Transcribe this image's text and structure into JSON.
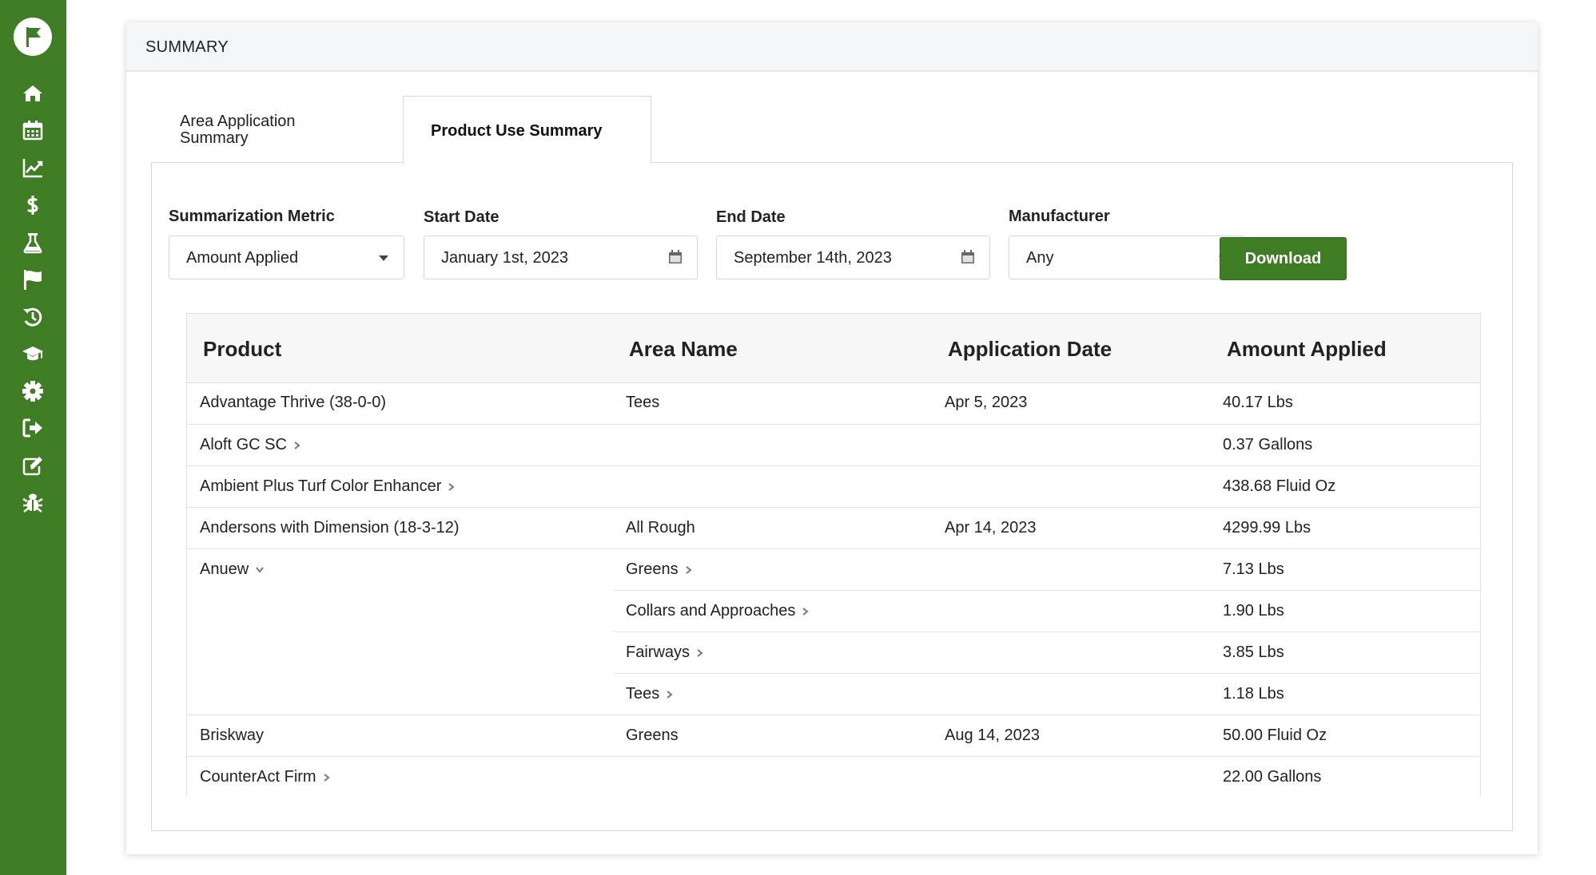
{
  "card": {
    "title": "SUMMARY"
  },
  "tabs": [
    {
      "label": "Area Application Summary",
      "active": false
    },
    {
      "label": "Product Use Summary",
      "active": true
    }
  ],
  "filters": {
    "metric": {
      "label": "Summarization Metric",
      "value": "Amount Applied"
    },
    "start_date": {
      "label": "Start Date",
      "value": "January 1st, 2023"
    },
    "end_date": {
      "label": "End Date",
      "value": "September 14th, 2023"
    },
    "manufacturer": {
      "label": "Manufacturer",
      "value": "Any"
    },
    "download_label": "Download"
  },
  "table": {
    "columns": [
      "Product",
      "Area Name",
      "Application Date",
      "Amount Applied"
    ],
    "rows": [
      {
        "product": "Advantage Thrive (38-0-0)",
        "area": "Tees",
        "date": "Apr 5, 2023",
        "amount": "40.17 Lbs"
      },
      {
        "product": "Aloft GC SC",
        "product_chevron": "right",
        "area": "",
        "date": "",
        "amount": "0.37 Gallons"
      },
      {
        "product": "Ambient Plus Turf Color Enhancer",
        "product_chevron": "right",
        "area": "",
        "date": "",
        "amount": "438.68 Fluid Oz"
      },
      {
        "product": "Andersons with Dimension (18-3-12)",
        "area": "All Rough",
        "date": "Apr 14, 2023",
        "amount": "4299.99 Lbs"
      },
      {
        "product": "Anuew",
        "product_chevron": "down",
        "area": "Greens",
        "area_chevron": "right",
        "date": "",
        "amount": "7.13 Lbs"
      },
      {
        "product": "",
        "area": "Collars and Approaches",
        "area_chevron": "right",
        "date": "",
        "amount": "1.90 Lbs"
      },
      {
        "product": "",
        "area": "Fairways",
        "area_chevron": "right",
        "date": "",
        "amount": "3.85 Lbs"
      },
      {
        "product": "",
        "area": "Tees",
        "area_chevron": "right",
        "date": "",
        "amount": "1.18 Lbs"
      },
      {
        "product": "Briskway",
        "area": "Greens",
        "date": "Aug 14, 2023",
        "amount": "50.00 Fluid Oz"
      },
      {
        "product": "CounterAct Firm",
        "product_chevron": "right",
        "area": "",
        "date": "",
        "amount": "22.00 Gallons"
      }
    ]
  },
  "sidebar": {
    "accent": "#3f7d24",
    "icons": [
      "flag-logo-icon",
      "home-icon",
      "calendar-icon",
      "chart-line-icon",
      "dollar-icon",
      "flask-icon",
      "flag-icon",
      "history-icon",
      "graduation-cap-icon",
      "gear-icon",
      "sign-out-icon",
      "edit-icon",
      "bug-icon"
    ]
  }
}
